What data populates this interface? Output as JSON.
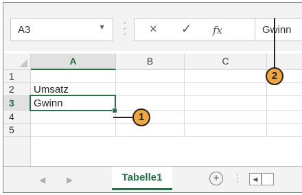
{
  "formula_bar": {
    "name_box": "A3",
    "cancel_icon": "×",
    "enter_icon": "✓",
    "fx_icon": "fx",
    "content": "Gwinn"
  },
  "columns": [
    "A",
    "B",
    "C"
  ],
  "rows": [
    {
      "num": "1",
      "a": ""
    },
    {
      "num": "2",
      "a": "Umsatz"
    },
    {
      "num": "3",
      "a": "Gwinn"
    },
    {
      "num": "4",
      "a": ""
    },
    {
      "num": "5",
      "a": ""
    }
  ],
  "sheet_tabs": {
    "prev": "◀",
    "next": "▶",
    "active_tab": "Tabelle1",
    "add_label": "+",
    "scroll_left": "◀"
  },
  "callouts": {
    "one": "1",
    "two": "2"
  },
  "colors": {
    "accent": "#217346",
    "callout": "#f0a63a"
  }
}
